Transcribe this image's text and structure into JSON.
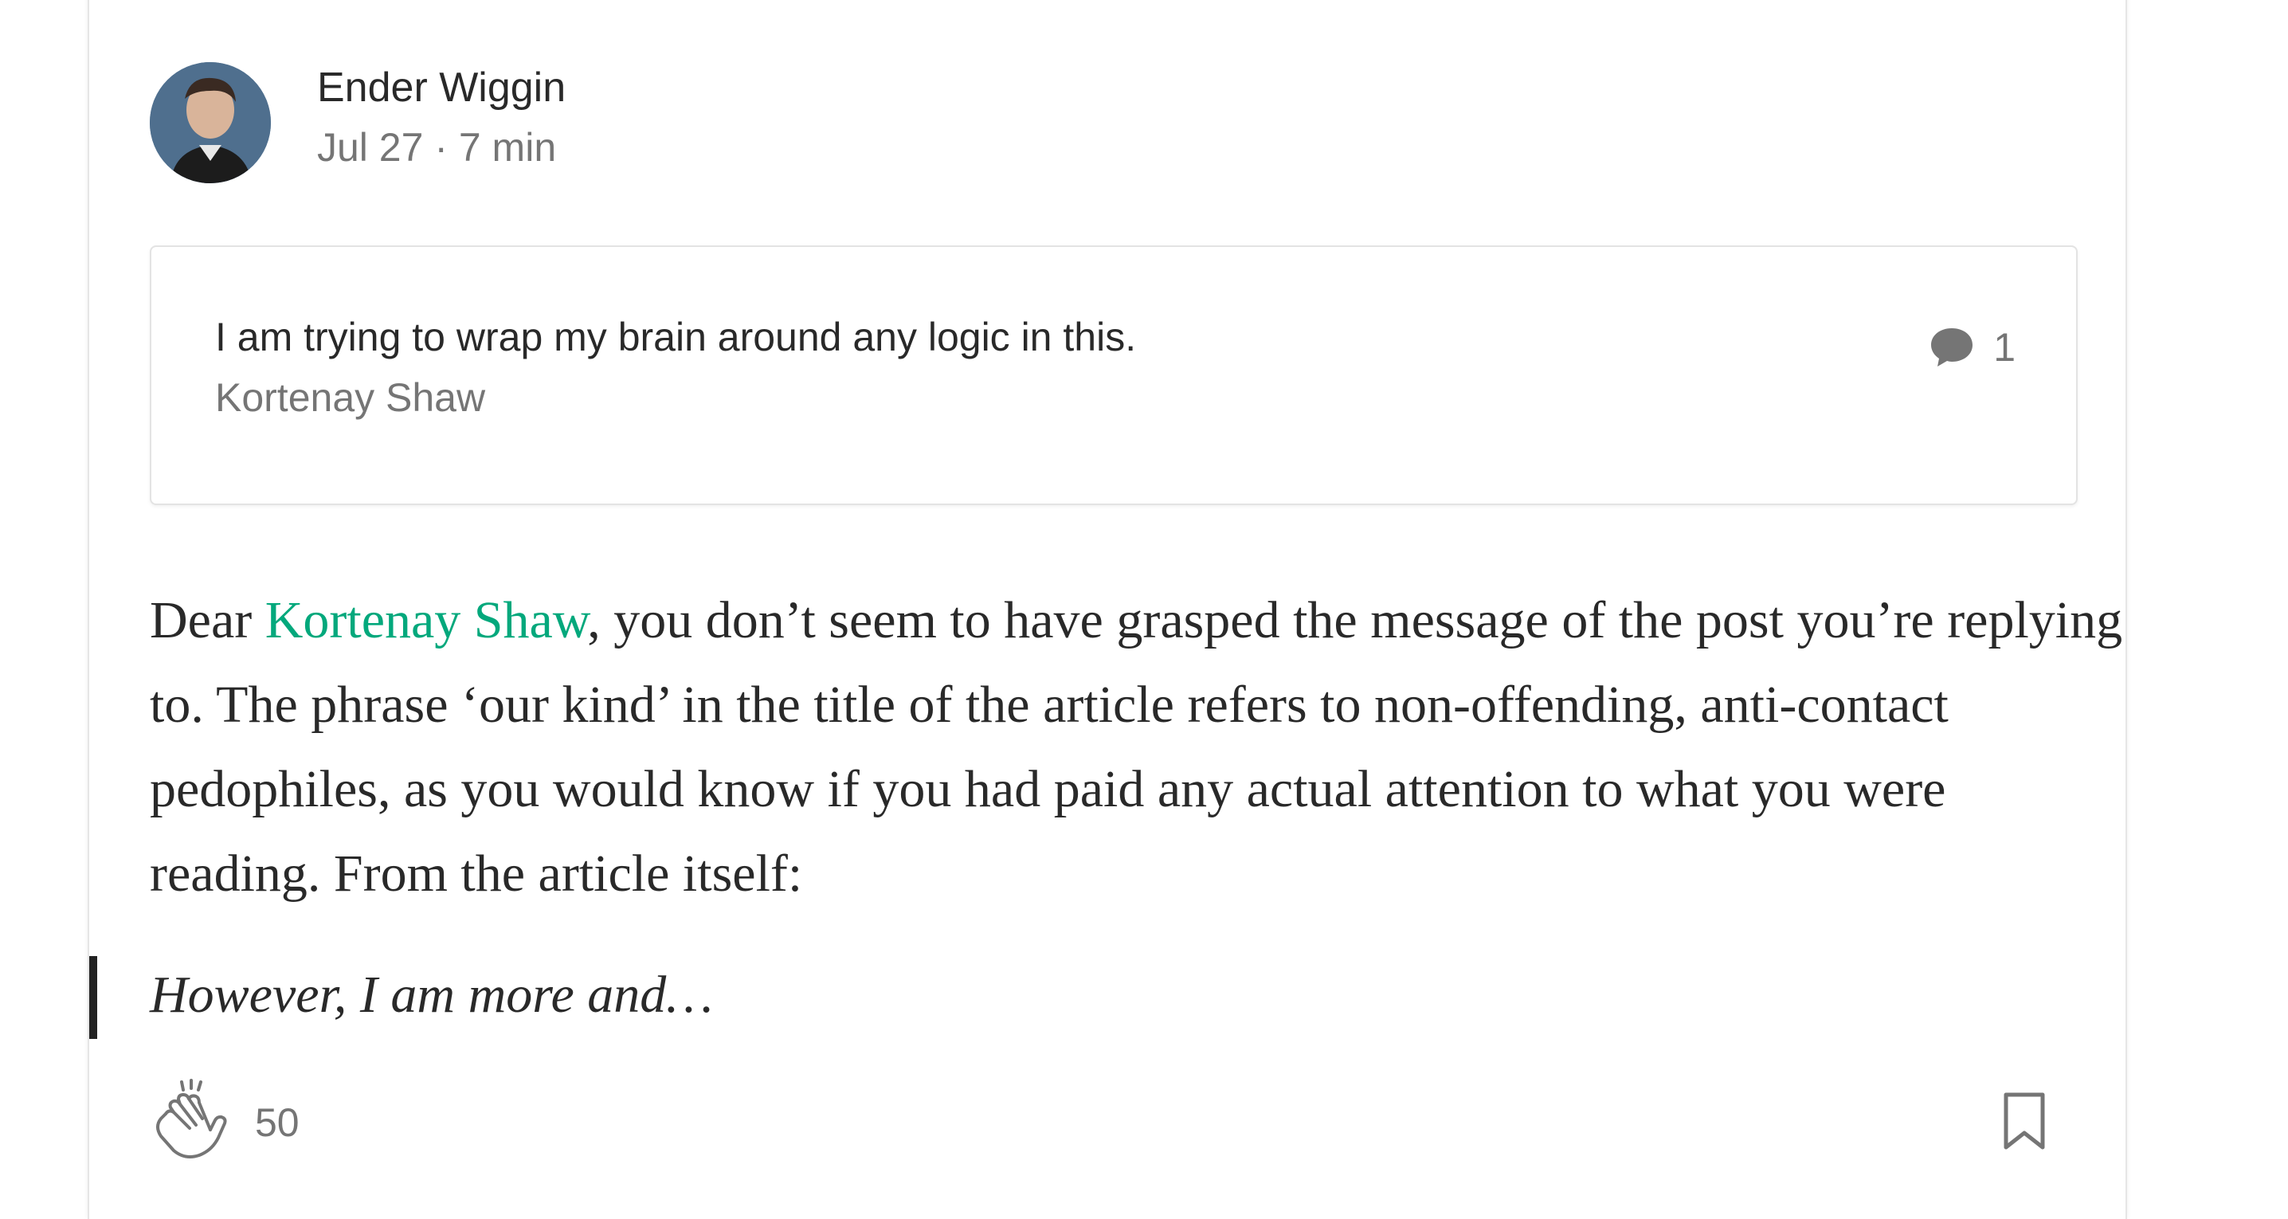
{
  "author": {
    "name": "Ender Wiggin",
    "meta": "Jul 27 · 7 min"
  },
  "quote": {
    "text": "I am trying to wrap my brain around any logic in this.",
    "author": "Kortenay Shaw",
    "response_count": "1"
  },
  "body": {
    "prefix": "Dear ",
    "mention": "Kortenay Shaw",
    "text": ", you don’t seem to have grasped the message of the post you’re replying to. The phrase ‘our kind’ in the title of the article refers to non-offending, anti-contact pedophiles, as you would know if you had paid any actual attention to what you were reading. From the article itself:"
  },
  "blockquote": {
    "text": "However, I am more and…"
  },
  "footer": {
    "clap_count": "50"
  },
  "colors": {
    "mention": "#03a87c",
    "text": "#292929",
    "muted": "#757575",
    "blockquote_bar": "#222222"
  },
  "icons": {
    "response": "speech-bubble-icon",
    "clap": "clap-hands-icon",
    "bookmark": "bookmark-icon"
  }
}
